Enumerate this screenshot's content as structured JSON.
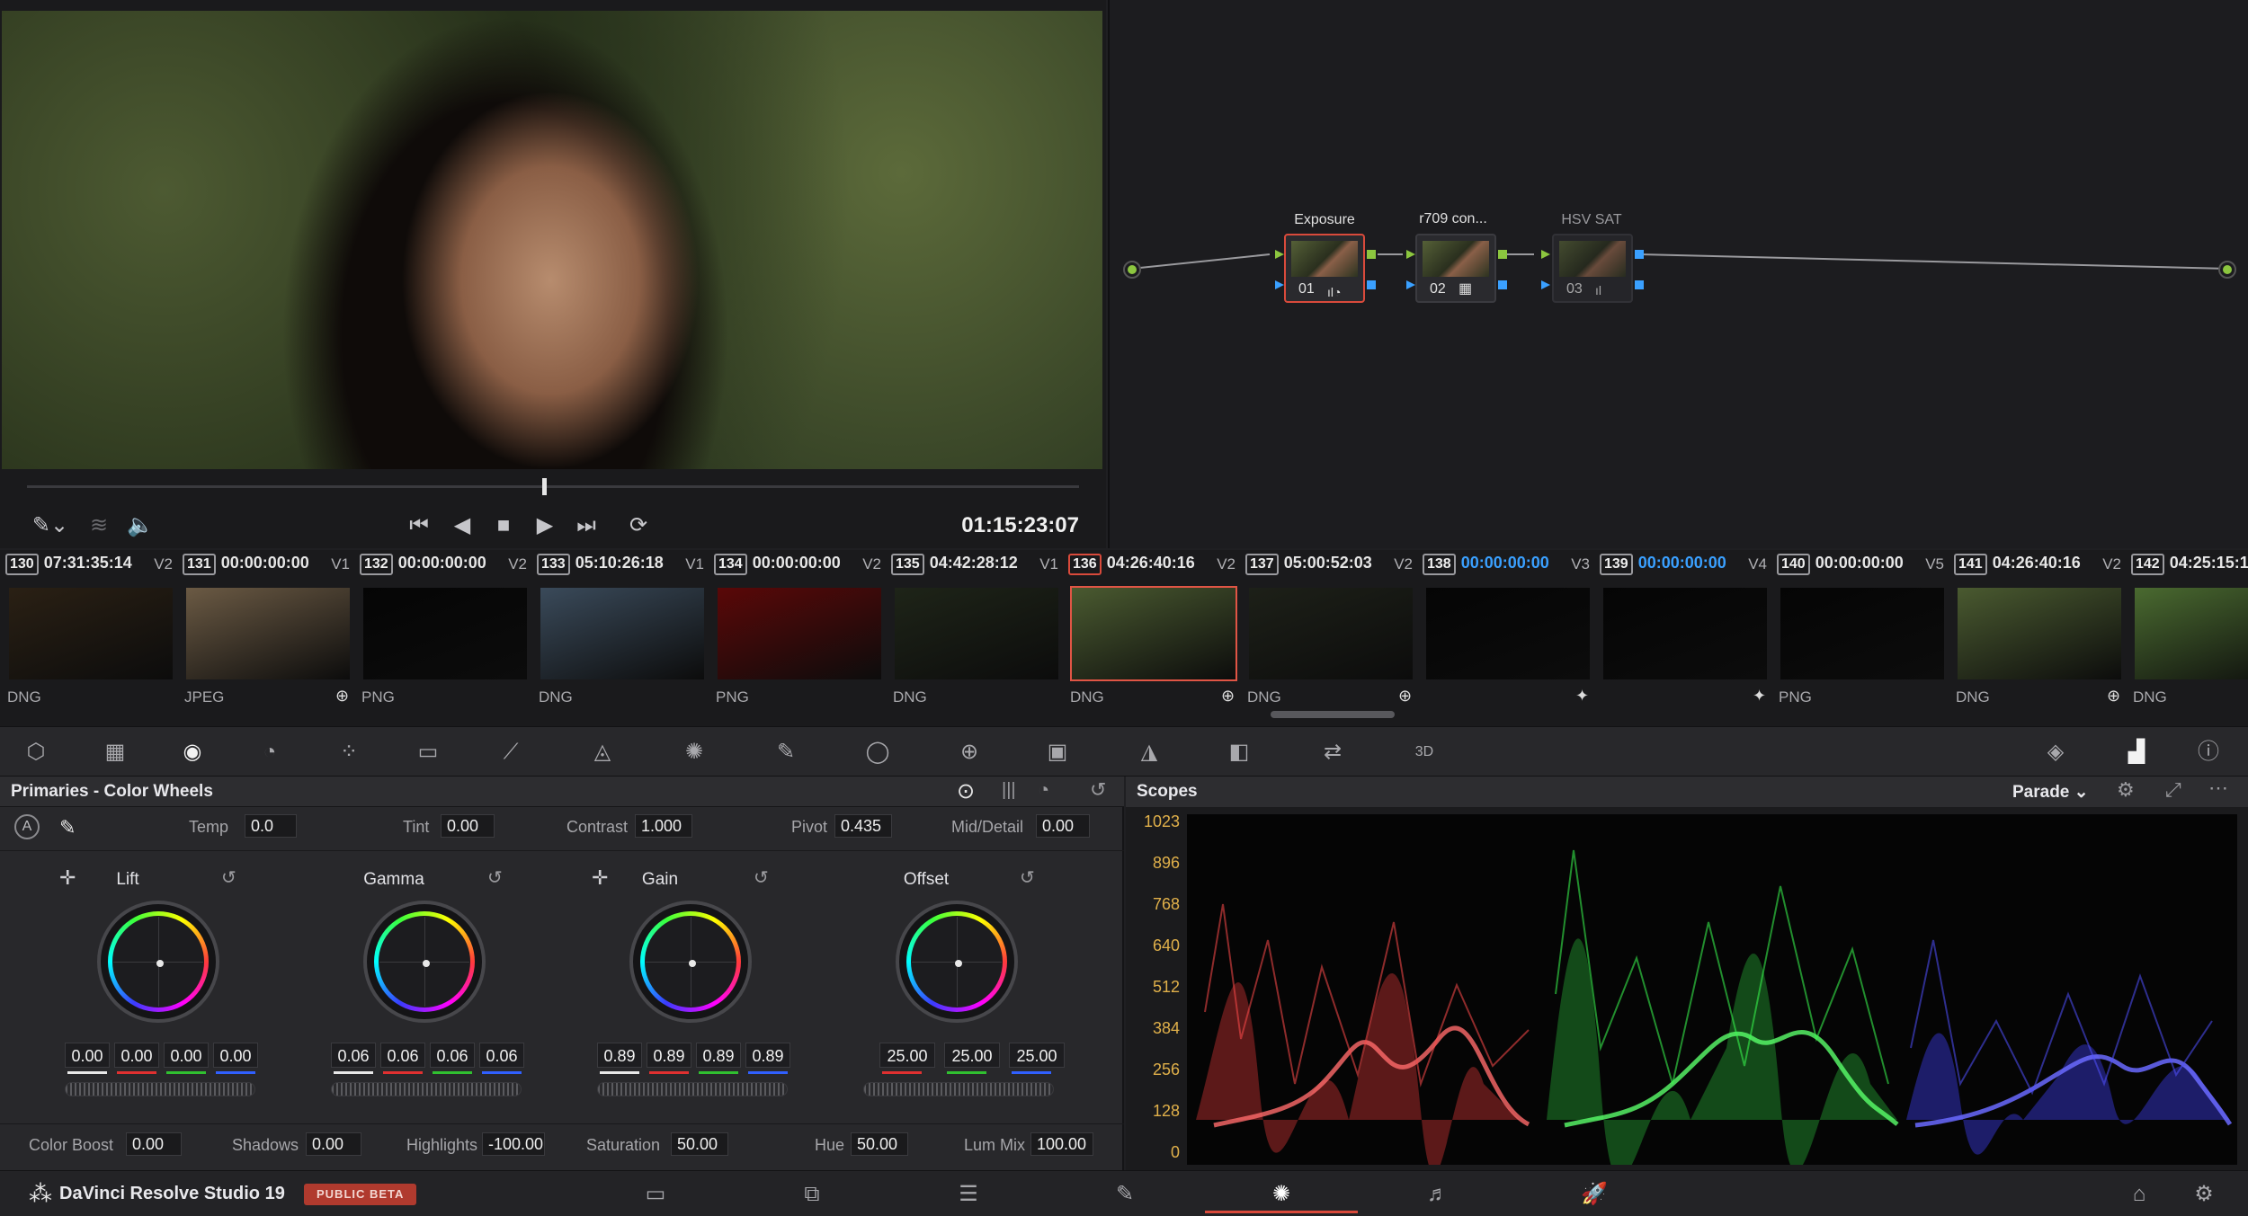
{
  "viewer": {
    "timecode": "01:15:23:07",
    "controls": {
      "picker": "eyedropper-icon",
      "layers": "layers-icon",
      "volume": "speaker-icon",
      "first": "skip-back-icon",
      "prev": "step-back-icon",
      "stop": "stop-icon",
      "play": "play-icon",
      "last": "skip-forward-icon",
      "loop": "loop-icon"
    },
    "playhead_progress": 0.49
  },
  "nodes": [
    {
      "label": "Exposure",
      "num": "01",
      "selected": true
    },
    {
      "label": "r709 con...",
      "num": "02",
      "selected": false
    },
    {
      "label": "HSV SAT",
      "num": "03",
      "selected": false
    }
  ],
  "clips": [
    {
      "num": "130",
      "tc": "07:31:35:14",
      "track": "V2",
      "fmt": "DNG",
      "icon": "",
      "selected": false,
      "tc_blue": false
    },
    {
      "num": "131",
      "tc": "00:00:00:00",
      "track": "V1",
      "fmt": "JPEG",
      "icon": "⊕",
      "selected": false,
      "tc_blue": false
    },
    {
      "num": "132",
      "tc": "00:00:00:00",
      "track": "V2",
      "fmt": "PNG",
      "icon": "",
      "selected": false,
      "tc_blue": false
    },
    {
      "num": "133",
      "tc": "05:10:26:18",
      "track": "V1",
      "fmt": "DNG",
      "icon": "",
      "selected": false,
      "tc_blue": false
    },
    {
      "num": "134",
      "tc": "00:00:00:00",
      "track": "V2",
      "fmt": "PNG",
      "icon": "",
      "selected": false,
      "tc_blue": false
    },
    {
      "num": "135",
      "tc": "04:42:28:12",
      "track": "V1",
      "fmt": "DNG",
      "icon": "",
      "selected": false,
      "tc_blue": false
    },
    {
      "num": "136",
      "tc": "04:26:40:16",
      "track": "V2",
      "fmt": "DNG",
      "icon": "⊕",
      "selected": true,
      "tc_blue": false
    },
    {
      "num": "137",
      "tc": "05:00:52:03",
      "track": "V2",
      "fmt": "DNG",
      "icon": "⊕",
      "selected": false,
      "tc_blue": false
    },
    {
      "num": "138",
      "tc": "00:00:00:00",
      "track": "V3",
      "fmt": "",
      "icon": "✦",
      "selected": false,
      "tc_blue": true
    },
    {
      "num": "139",
      "tc": "00:00:00:00",
      "track": "V4",
      "fmt": "",
      "icon": "✦",
      "selected": false,
      "tc_blue": true
    },
    {
      "num": "140",
      "tc": "00:00:00:00",
      "track": "V5",
      "fmt": "PNG",
      "icon": "",
      "selected": false,
      "tc_blue": false
    },
    {
      "num": "141",
      "tc": "04:26:40:16",
      "track": "V2",
      "fmt": "DNG",
      "icon": "⊕",
      "selected": false,
      "tc_blue": false
    },
    {
      "num": "142",
      "tc": "04:25:15:1",
      "track": "",
      "fmt": "DNG",
      "icon": "",
      "selected": false,
      "tc_blue": false
    }
  ],
  "palette_icons": [
    "camera-raw-icon",
    "color-match-icon",
    "color-wheels-icon",
    "hdr-wheels-icon",
    "rgb-mixer-icon",
    "motion-effects-icon",
    "curves-icon",
    "color-warper-icon",
    "qualifier-icon",
    "eyedropper-icon",
    "window-icon",
    "tracker-icon",
    "magic-mask-icon",
    "blur-icon",
    "key-icon",
    "sizing-icon",
    "3d-icon",
    "keyframes-icon",
    "scopes-icon",
    "info-icon"
  ],
  "color_wheels": {
    "title": "Primaries - Color Wheels",
    "temp_label": "Temp",
    "temp": "0.0",
    "tint_label": "Tint",
    "tint": "0.00",
    "contrast_label": "Contrast",
    "contrast": "1.000",
    "pivot_label": "Pivot",
    "pivot": "0.435",
    "middetail_label": "Mid/Detail",
    "middetail": "0.00",
    "auto_label": "A",
    "wheels": [
      {
        "name": "Lift",
        "values": [
          "0.00",
          "0.00",
          "0.00",
          "0.00"
        ]
      },
      {
        "name": "Gamma",
        "values": [
          "0.06",
          "0.06",
          "0.06",
          "0.06"
        ]
      },
      {
        "name": "Gain",
        "values": [
          "0.89",
          "0.89",
          "0.89",
          "0.89"
        ]
      },
      {
        "name": "Offset",
        "values": [
          "25.00",
          "25.00",
          "25.00"
        ]
      }
    ],
    "colorboost_label": "Color Boost",
    "colorboost": "0.00",
    "shadows_label": "Shadows",
    "shadows": "0.00",
    "highlights_label": "Highlights",
    "highlights": "-100.00",
    "saturation_label": "Saturation",
    "saturation": "50.00",
    "hue_label": "Hue",
    "hue": "50.00",
    "lummix_label": "Lum Mix",
    "lummix": "100.00"
  },
  "scopes": {
    "title": "Scopes",
    "mode": "Parade",
    "y_ticks": [
      "1023",
      "896",
      "768",
      "640",
      "512",
      "384",
      "256",
      "128",
      "0"
    ]
  },
  "bottom": {
    "app_name": "DaVinci Resolve Studio 19",
    "badge": "PUBLIC BETA",
    "pages": [
      "media-page-icon",
      "cut-page-icon",
      "edit-page-icon",
      "fusion-page-icon",
      "color-page-icon",
      "fairlight-page-icon",
      "deliver-page-icon"
    ],
    "active_page": 4
  },
  "colors": {
    "accent_red": "#d94a3b",
    "scope_gold": "#e0b04a",
    "clip_blue_tc": "#3aa0ff"
  }
}
